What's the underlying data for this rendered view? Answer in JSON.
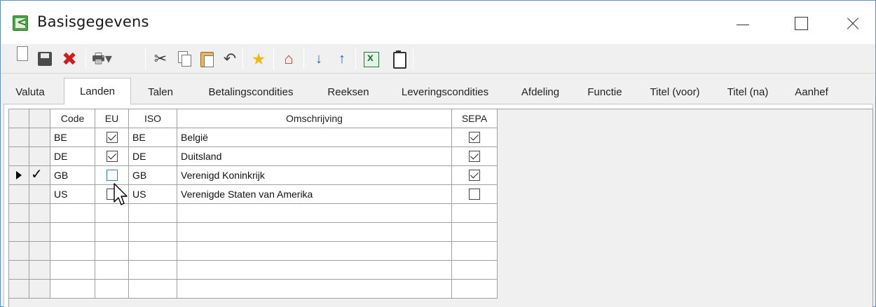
{
  "window": {
    "title": "Basisgegevens",
    "controls": {
      "minimize": "minimize",
      "maximize": "maximize",
      "close": "close"
    }
  },
  "toolbar": {
    "buttons": [
      {
        "name": "new-document-icon"
      },
      {
        "name": "save-icon"
      },
      {
        "name": "delete-icon"
      },
      {
        "name": "print-icon"
      },
      {
        "name": "cut-icon"
      },
      {
        "name": "copy-icon"
      },
      {
        "name": "paste-icon"
      },
      {
        "name": "undo-icon"
      },
      {
        "name": "add-favorite-icon"
      },
      {
        "name": "home-icon"
      },
      {
        "name": "sort-descending-icon"
      },
      {
        "name": "sort-ascending-icon"
      },
      {
        "name": "excel-export-icon"
      },
      {
        "name": "clipboard-icon"
      }
    ]
  },
  "tabs": [
    {
      "label": "Valuta"
    },
    {
      "label": "Landen",
      "active": true
    },
    {
      "label": "Talen"
    },
    {
      "label": "Betalingscondities"
    },
    {
      "label": "Reeksen"
    },
    {
      "label": "Leveringscondities"
    },
    {
      "label": "Afdeling"
    },
    {
      "label": "Functie"
    },
    {
      "label": "Titel (voor)"
    },
    {
      "label": "Titel (na)"
    },
    {
      "label": "Aanhef"
    }
  ],
  "grid": {
    "columns": [
      "Code",
      "EU",
      "ISO",
      "Omschrijving",
      "SEPA"
    ],
    "rows": [
      {
        "code": "BE",
        "eu": true,
        "iso": "BE",
        "omschrijving": "België",
        "sepa": true
      },
      {
        "code": "DE",
        "eu": true,
        "iso": "DE",
        "omschrijving": "Duitsland",
        "sepa": true
      },
      {
        "code": "GB",
        "eu": false,
        "iso": "GB",
        "omschrijving": "Verenigd Koninkrijk",
        "sepa": true,
        "current": true
      },
      {
        "code": "US",
        "eu": false,
        "iso": "US",
        "omschrijving": "Verenigde Staten van Amerika",
        "sepa": false
      }
    ]
  },
  "colors": {
    "window_border": "#5a8fd0",
    "grid_line": "#a0a0a0",
    "focus": "#2b7ad6"
  }
}
